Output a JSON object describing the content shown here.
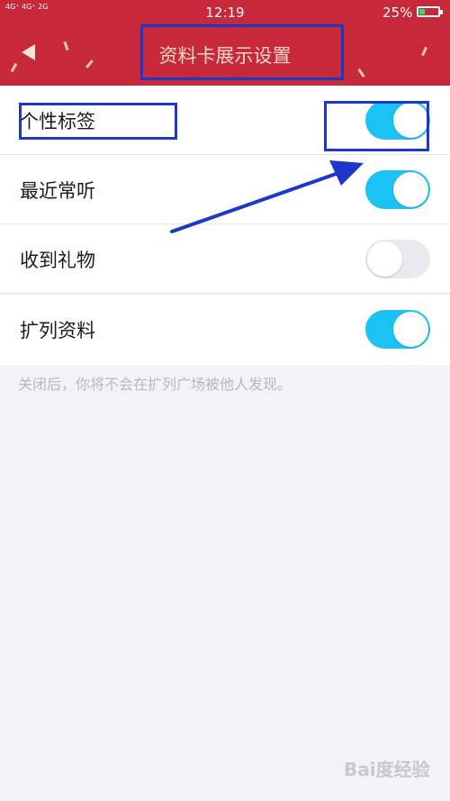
{
  "status_bar": {
    "signal": "4G⁺ 4G⁺ 2G",
    "time": "12:19",
    "battery": "25%"
  },
  "header": {
    "title": "资料卡展示设置"
  },
  "settings": [
    {
      "label": "个性标签",
      "enabled": true
    },
    {
      "label": "最近常听",
      "enabled": true
    },
    {
      "label": "收到礼物",
      "enabled": false
    },
    {
      "label": "扩列资料",
      "enabled": true
    }
  ],
  "hint": "关闭后，你将不会在扩列广场被他人发现。",
  "watermark": "Bai度经验",
  "colors": {
    "header": "#c8293a",
    "toggle_on": "#1bc2f4",
    "toggle_off": "#e9eaf0",
    "annotation": "#1b38c8"
  }
}
